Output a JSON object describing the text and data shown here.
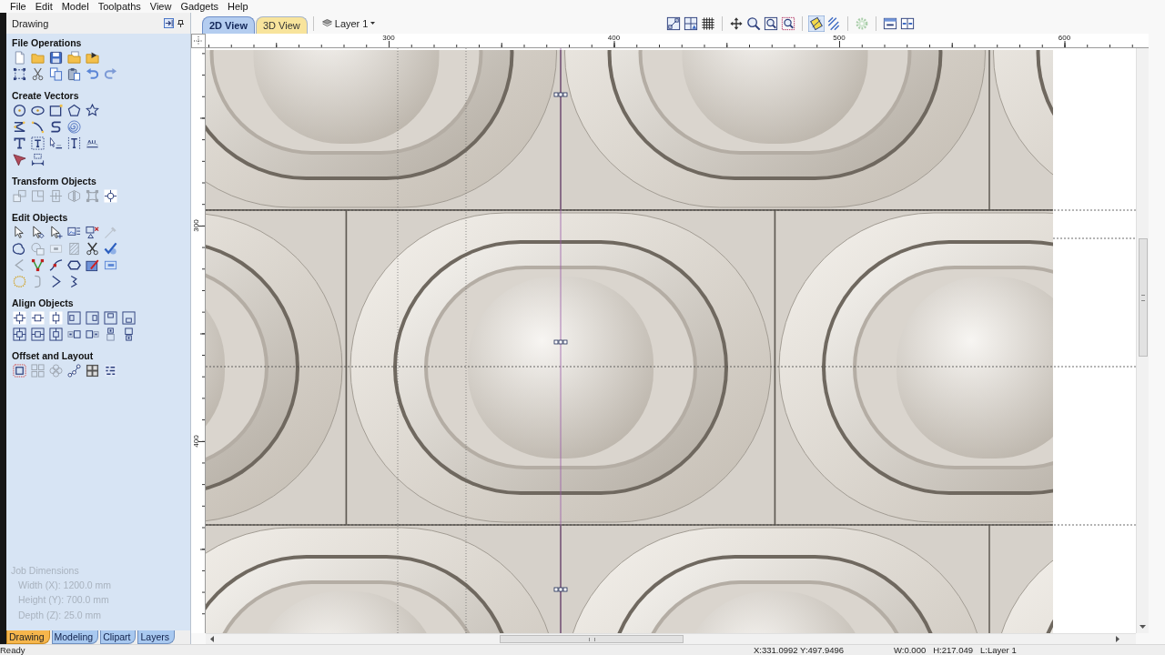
{
  "menu": [
    "File",
    "Edit",
    "Model",
    "Toolpaths",
    "View",
    "Gadgets",
    "Help"
  ],
  "panel": {
    "title": "Drawing",
    "sections": [
      {
        "title": "File Operations",
        "tool_rows": [
          [
            {
              "disabled": false
            },
            {
              "disabled": false
            },
            {
              "disabled": false
            },
            {
              "disabled": false
            },
            {
              "disabled": false
            }
          ],
          [
            {
              "disabled": false
            },
            {
              "disabled": false
            },
            {
              "disabled": false
            },
            {
              "disabled": false
            },
            {
              "disabled": false
            },
            {
              "disabled": false
            }
          ]
        ]
      },
      {
        "title": "Create Vectors",
        "tool_rows": [
          [
            {
              "disabled": false
            },
            {
              "disabled": false
            },
            {
              "disabled": false
            },
            {
              "disabled": false
            },
            {
              "disabled": false
            }
          ],
          [
            {
              "disabled": false
            },
            {
              "disabled": false
            },
            {
              "disabled": false
            },
            {
              "disabled": false
            }
          ],
          [
            {
              "disabled": false
            },
            {
              "disabled": false
            },
            {
              "disabled": false
            },
            {
              "disabled": false
            },
            {
              "disabled": false
            }
          ],
          [
            {
              "disabled": false
            },
            {
              "disabled": false
            }
          ]
        ]
      },
      {
        "title": "Transform Objects",
        "tool_rows": [
          [
            {
              "disabled": true
            },
            {
              "disabled": true
            },
            {
              "disabled": true
            },
            {
              "disabled": true
            },
            {
              "disabled": true
            },
            {
              "disabled": false
            }
          ]
        ]
      },
      {
        "title": "Edit Objects",
        "tool_rows": [
          [
            {
              "disabled": false
            },
            {
              "disabled": false
            },
            {
              "disabled": false
            },
            {
              "disabled": false
            },
            {
              "disabled": false
            },
            {
              "disabled": true
            }
          ],
          [
            {
              "disabled": false
            },
            {
              "disabled": true
            },
            {
              "disabled": true
            },
            {
              "disabled": true
            },
            {
              "disabled": false
            },
            {
              "disabled": false
            }
          ],
          [
            {
              "disabled": true
            },
            {
              "disabled": false
            },
            {
              "disabled": false
            },
            {
              "disabled": false
            },
            {
              "disabled": false
            },
            {
              "disabled": false
            }
          ],
          [
            {
              "disabled": false
            },
            {
              "disabled": true
            },
            {
              "disabled": false
            },
            {
              "disabled": false
            }
          ]
        ]
      },
      {
        "title": "Align Objects",
        "tool_rows": [
          [
            {
              "disabled": false
            },
            {
              "disabled": false
            },
            {
              "disabled": false
            },
            {
              "disabled": false
            },
            {
              "disabled": false
            },
            {
              "disabled": false
            },
            {
              "disabled": false
            }
          ],
          [
            {
              "disabled": false
            },
            {
              "disabled": false
            },
            {
              "disabled": false
            },
            {
              "disabled": false
            },
            {
              "disabled": false
            },
            {
              "disabled": false
            },
            {
              "disabled": false
            }
          ]
        ]
      },
      {
        "title": "Offset and Layout",
        "tool_rows": [
          [
            {
              "disabled": false
            },
            {
              "disabled": true
            },
            {
              "disabled": true
            },
            {
              "disabled": false
            },
            {
              "disabled": false
            },
            {
              "disabled": false
            }
          ]
        ]
      }
    ],
    "job_dimensions": {
      "title": "Job Dimensions",
      "disabled": true,
      "lines": [
        "Width (X): 1200.0 mm",
        "Height (Y): 700.0 mm",
        "Depth (Z): 25.0 mm"
      ]
    },
    "tabs": [
      {
        "label": "Drawing",
        "selected": true
      },
      {
        "label": "Modeling",
        "selected": false
      },
      {
        "label": "Clipart",
        "selected": false
      },
      {
        "label": "Layers",
        "selected": false
      }
    ]
  },
  "view_tabs": [
    {
      "label": "2D View",
      "selected": true,
      "color": "#b4cdf0"
    },
    {
      "label": "3D View",
      "selected": false,
      "color": "#f8e49c"
    }
  ],
  "layer_dropdown": {
    "label": "Layer 1"
  },
  "toolbar_groups": [
    [
      {
        "pressed": false,
        "disabled": false
      },
      {
        "pressed": false,
        "disabled": false
      },
      {
        "pressed": false,
        "disabled": false
      }
    ],
    [
      {
        "pressed": false,
        "disabled": false
      },
      {
        "pressed": false,
        "disabled": false
      },
      {
        "pressed": false,
        "disabled": false
      },
      {
        "pressed": false,
        "disabled": false
      }
    ],
    [
      {
        "pressed": true,
        "disabled": false
      },
      {
        "pressed": false,
        "disabled": false
      }
    ],
    [
      {
        "pressed": false,
        "disabled": true
      }
    ],
    [
      {
        "pressed": false,
        "disabled": false
      },
      {
        "pressed": false,
        "disabled": false
      }
    ]
  ],
  "rulers": {
    "top_labels": [
      "300",
      "400",
      "500",
      "600"
    ],
    "left_labels": [
      "300",
      "400"
    ]
  },
  "status_bar": {
    "message": "Ready",
    "position": "X:331.0992 Y:497.9496",
    "size": [
      "W:0.000",
      "H:217.049"
    ],
    "layer": "L:Layer 1"
  }
}
